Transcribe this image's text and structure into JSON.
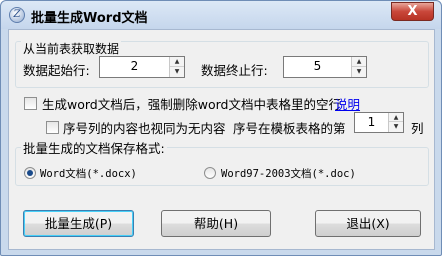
{
  "window": {
    "title": "批量生成Word文档",
    "close_label": "X"
  },
  "group1": {
    "label": "从当前表获取数据",
    "start_row_label": "数据起始行:",
    "start_row_value": "2",
    "end_row_label": "数据终止行:",
    "end_row_value": "5"
  },
  "option1": {
    "label": "生成word文档后，强制删除word文档中表格里的空行",
    "link": "说明"
  },
  "option2": {
    "label": "序号列的内容也视同为无内容",
    "seq_prefix": "序号在模板表格的第",
    "seq_value": "1",
    "seq_suffix": "列"
  },
  "group2": {
    "label": "批量生成的文档保存格式:",
    "format_docx": "Word文档(*.docx)",
    "format_doc": "Word97-2003文档(*.doc)"
  },
  "buttons": {
    "generate": "批量生成(P)",
    "help": "帮助(H)",
    "exit": "退出(X)"
  }
}
